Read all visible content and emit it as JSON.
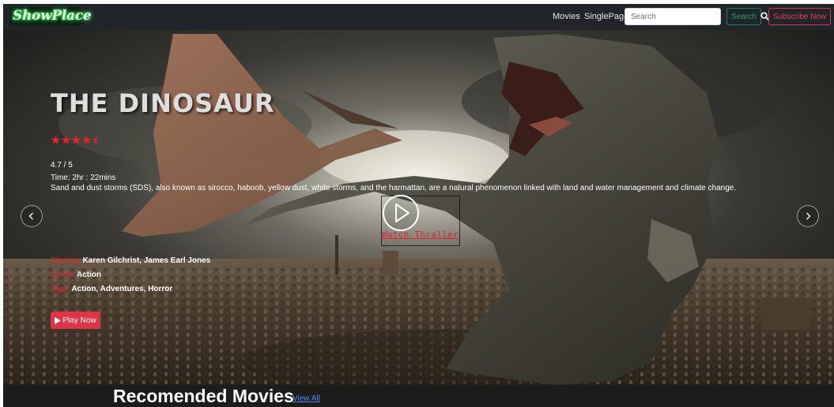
{
  "navbar": {
    "brand": "ShowPlace",
    "links": [
      "Movies",
      "SinglePage"
    ],
    "search_placeholder": "Search",
    "search_button": "Search",
    "subscribe_button": "Subscribe Now"
  },
  "hero": {
    "title": "THE DINOSAUR",
    "rating_stars": 4.5,
    "rating": "4.7 / 5",
    "time": "Time: 2hr : 22mins",
    "description": "Sand and dust storms (SDS), also known as sirocco, haboob, yellow dust, white storms, and the harmattan, are a natural phenomenon linked with land and water management and climate change.",
    "trailer_label": "Watch Thraller",
    "starring_label": "Starring:",
    "starring": "Karen Gilchrist, James Earl Jones",
    "genre_label": "Genre:",
    "genre": "Action",
    "tags_label": "Tags:",
    "tags": "Action, Adventures, Horror",
    "play_button": "Play Now"
  },
  "section": {
    "title": "Recomended Movies",
    "view_all": "View All"
  },
  "colors": {
    "accent_red": "#dc3545",
    "search_green": "#198754",
    "navbar_bg": "#212529",
    "brand_glow": "#39ff5a",
    "link_blue": "#5a8dee"
  },
  "icons": [
    "search-icon",
    "star-icon",
    "half-star-icon",
    "play-circle-icon",
    "play-icon",
    "chevron-left-icon",
    "chevron-right-icon"
  ]
}
